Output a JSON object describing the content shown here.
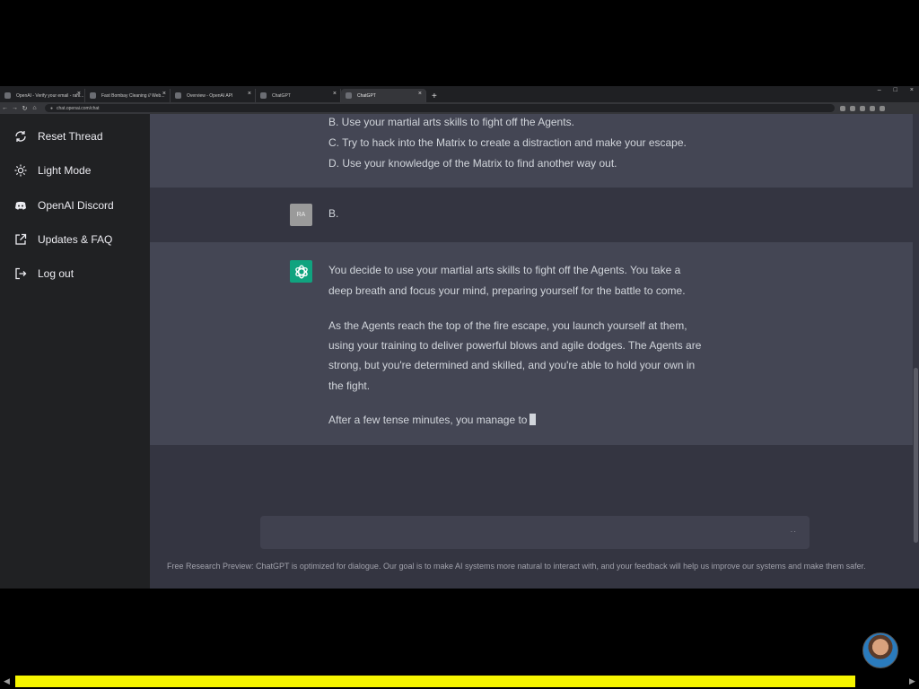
{
  "browser": {
    "tabs": [
      {
        "label": "OpenAI - Verify your email - rahi..."
      },
      {
        "label": "Fast Bombay Cleaning // Web..."
      },
      {
        "label": "Overview - OpenAI API"
      },
      {
        "label": "ChatGPT"
      },
      {
        "label": "ChatGPT"
      }
    ],
    "new_tab": "+",
    "url": "chat.openai.com/chat",
    "window_controls": {
      "minimize": "–",
      "maximize": "□",
      "close": "×"
    }
  },
  "sidebar": {
    "items": [
      {
        "label": "Reset Thread",
        "icon": "refresh-icon"
      },
      {
        "label": "Light Mode",
        "icon": "sun-icon"
      },
      {
        "label": "OpenAI Discord",
        "icon": "discord-icon"
      },
      {
        "label": "Updates & FAQ",
        "icon": "external-link-icon"
      },
      {
        "label": "Log out",
        "icon": "logout-icon"
      }
    ]
  },
  "conversation": {
    "prev_ai_lines": [
      "B. Use your martial arts skills to fight off the Agents.",
      "C. Try to hack into the Matrix to create a distraction and make your escape.",
      "D. Use your knowledge of the Matrix to find another way out."
    ],
    "user_message": {
      "avatar_initials": "RA",
      "text": "B."
    },
    "ai_response": {
      "lines": [
        "You decide to use your martial arts skills to fight off the Agents. You take a",
        "deep breath and focus your mind, preparing yourself for the battle to come.",
        "As the Agents reach the top of the fire escape, you launch yourself at them,",
        "using your training to deliver powerful blows and agile dodges. The Agents are",
        "strong, but you're determined and skilled, and you're able to hold your own in",
        "the fight.",
        "After a few tense minutes, you manage to"
      ]
    }
  },
  "input": {
    "send_indicator": "··"
  },
  "footer": {
    "text": "Free Research Preview: ChatGPT is optimized for dialogue. Our goal is to make AI systems more natural to interact with, and your feedback will help us improve our systems and make them safer."
  },
  "colors": {
    "sidebar": "#202123",
    "main": "#343541",
    "ai_block": "#444654",
    "accent": "#10a37f",
    "progress": "#f6f500"
  }
}
